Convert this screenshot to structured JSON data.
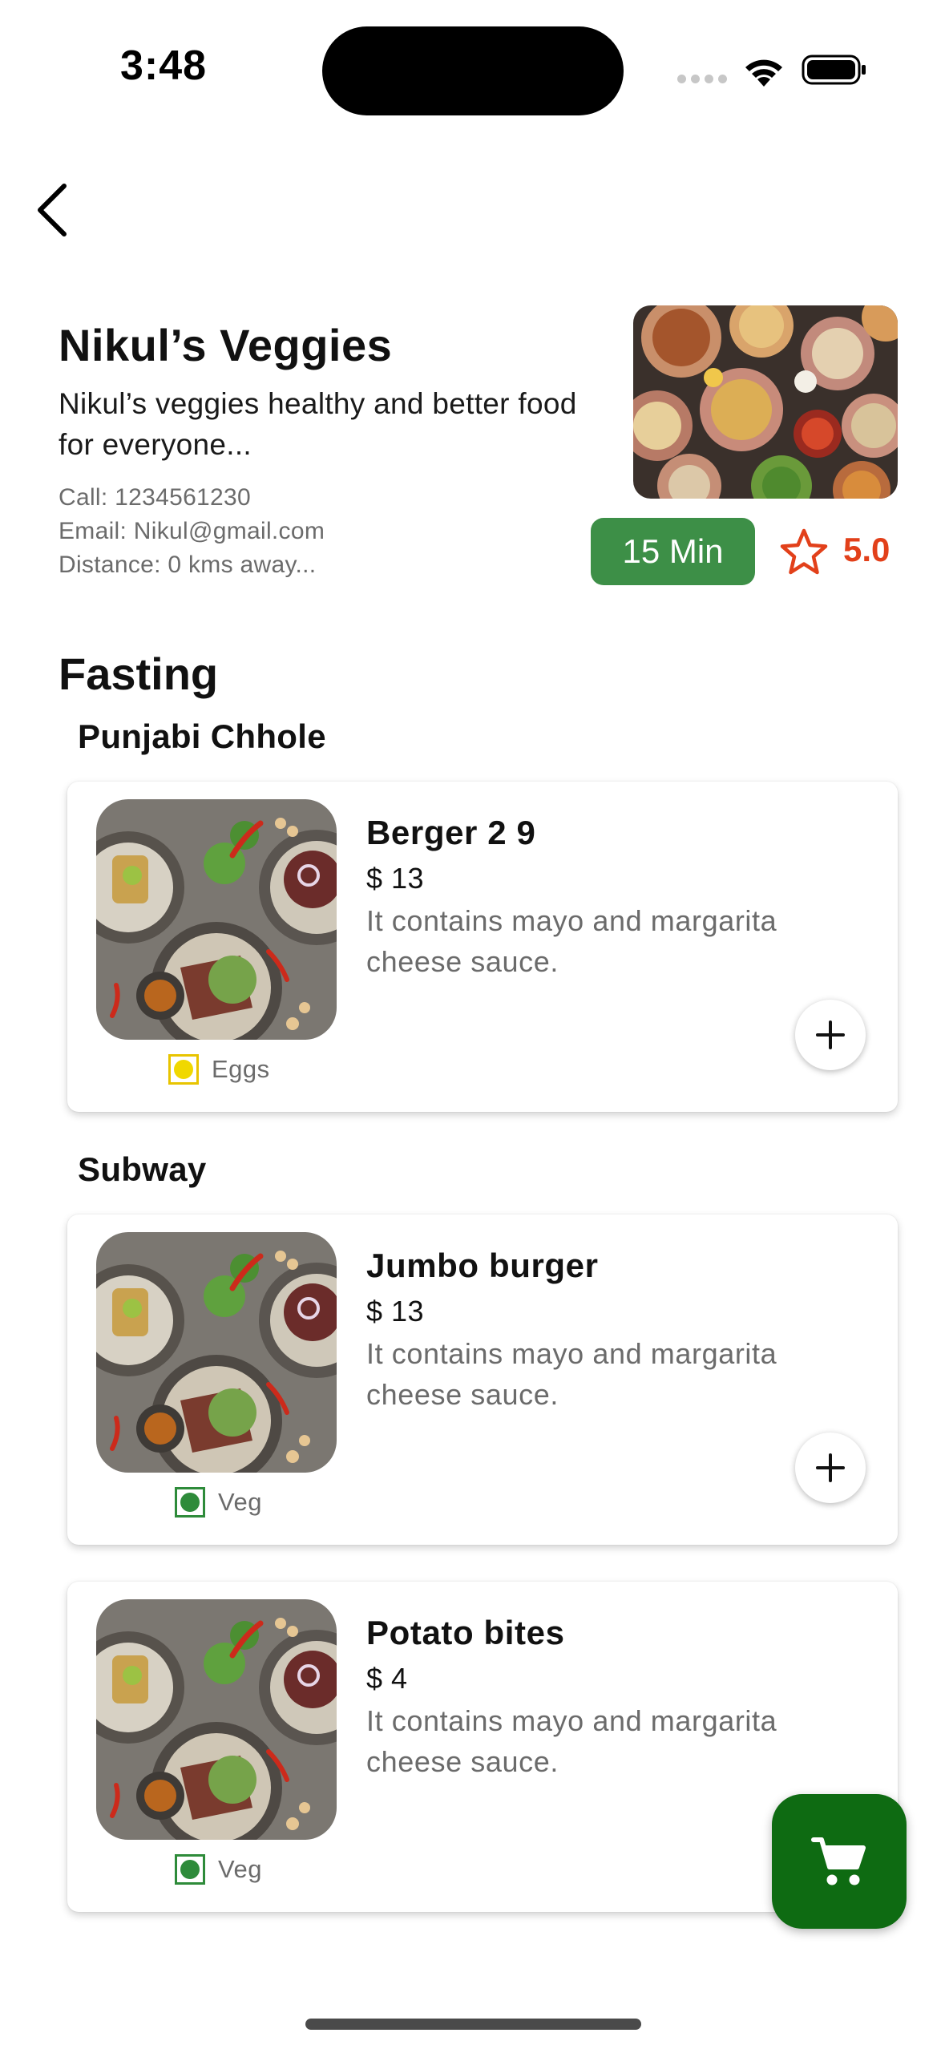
{
  "status_bar": {
    "time": "3:48"
  },
  "restaurant": {
    "name": "Nikul’s Veggies",
    "description": "Nikul’s veggies healthy and better food for everyone...",
    "call": "Call: 1234561230",
    "email": "Email: Nikul@gmail.com",
    "distance": "Distance: 0 kms away...",
    "delivery_time": "15 Min",
    "rating": "5.0"
  },
  "menu": {
    "section_title": "Fasting",
    "groups": [
      {
        "title": "Punjabi Chhole",
        "items": [
          {
            "name": "Berger 2 9",
            "price": "$ 13",
            "description": "It contains mayo and margarita cheese sauce.",
            "diet_label": "Eggs",
            "diet_color": "#f0d800"
          }
        ]
      },
      {
        "title": "Subway",
        "items": [
          {
            "name": "Jumbo burger",
            "price": "$ 13",
            "description": "It contains mayo and margarita cheese sauce.",
            "diet_label": "Veg",
            "diet_color": "#2e8b3a"
          },
          {
            "name": "Potato bites",
            "price": "$ 4",
            "description": "It contains mayo and margarita cheese sauce.",
            "diet_label": "Veg",
            "diet_color": "#2e8b3a"
          }
        ]
      }
    ]
  },
  "icons": {
    "back": "chevron-left-icon",
    "rating": "star-outline-icon",
    "add": "plus-icon",
    "cart": "cart-icon"
  },
  "colors": {
    "accent_green": "#3d8f47",
    "fab_green": "#0e6b12",
    "rating_orange": "#e2401a"
  }
}
